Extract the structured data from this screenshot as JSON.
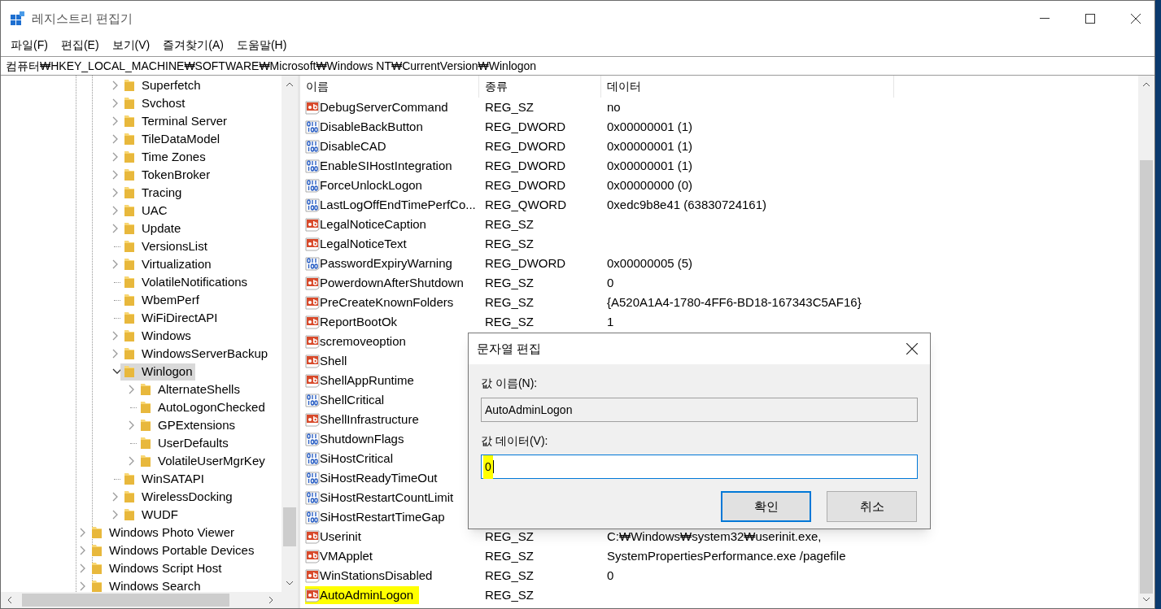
{
  "window": {
    "title": "레지스트리 편집기"
  },
  "menu": [
    "파일(F)",
    "편집(E)",
    "보기(V)",
    "즐겨찾기(A)",
    "도움말(H)"
  ],
  "address": "컴퓨터₩HKEY_LOCAL_MACHINE₩SOFTWARE₩Microsoft₩Windows NT₩CurrentVersion₩Winlogon",
  "tree": {
    "items": [
      {
        "kind": "branch",
        "label": "Superfetch",
        "expanded": false,
        "selected": false
      },
      {
        "kind": "branch",
        "label": "Svchost",
        "expanded": false,
        "selected": false
      },
      {
        "kind": "branch",
        "label": "Terminal Server",
        "expanded": false,
        "selected": false
      },
      {
        "kind": "branch",
        "label": "TileDataModel",
        "expanded": false,
        "selected": false
      },
      {
        "kind": "branch",
        "label": "Time Zones",
        "expanded": false,
        "selected": false
      },
      {
        "kind": "branch",
        "label": "TokenBroker",
        "expanded": false,
        "selected": false
      },
      {
        "kind": "branch",
        "label": "Tracing",
        "expanded": false,
        "selected": false
      },
      {
        "kind": "branch",
        "label": "UAC",
        "expanded": false,
        "selected": false
      },
      {
        "kind": "branch",
        "label": "Update",
        "expanded": false,
        "selected": false
      },
      {
        "kind": "leaf",
        "label": "VersionsList",
        "selected": false
      },
      {
        "kind": "branch",
        "label": "Virtualization",
        "expanded": false,
        "selected": false
      },
      {
        "kind": "leaf",
        "label": "VolatileNotifications",
        "selected": false
      },
      {
        "kind": "leaf",
        "label": "WbemPerf",
        "selected": false
      },
      {
        "kind": "leaf",
        "label": "WiFiDirectAPI",
        "selected": false
      },
      {
        "kind": "branch",
        "label": "Windows",
        "expanded": false,
        "selected": false
      },
      {
        "kind": "branch",
        "label": "WindowsServerBackup",
        "expanded": false,
        "selected": false
      },
      {
        "kind": "branch",
        "label": "Winlogon",
        "expanded": true,
        "selected": true,
        "children": [
          {
            "kind": "branch",
            "label": "AlternateShells",
            "expanded": false,
            "selected": false
          },
          {
            "kind": "leaf",
            "label": "AutoLogonChecked",
            "selected": false
          },
          {
            "kind": "branch",
            "label": "GPExtensions",
            "expanded": false,
            "selected": false
          },
          {
            "kind": "leaf",
            "label": "UserDefaults",
            "selected": false
          },
          {
            "kind": "branch",
            "label": "VolatileUserMgrKey",
            "expanded": false,
            "selected": false
          }
        ]
      },
      {
        "kind": "leaf",
        "label": "WinSATAPI",
        "selected": false
      },
      {
        "kind": "branch",
        "label": "WirelessDocking",
        "expanded": false,
        "selected": false
      },
      {
        "kind": "branch",
        "label": "WUDF",
        "expanded": false,
        "selected": false
      }
    ],
    "outer_items": [
      {
        "kind": "branch",
        "label": "Windows Photo Viewer",
        "expanded": false,
        "selected": false
      },
      {
        "kind": "branch",
        "label": "Windows Portable Devices",
        "expanded": false,
        "selected": false
      },
      {
        "kind": "branch",
        "label": "Windows Script Host",
        "expanded": false,
        "selected": false
      },
      {
        "kind": "branch",
        "label": "Windows Search",
        "expanded": false,
        "selected": false
      }
    ]
  },
  "list": {
    "columns": [
      "이름",
      "종류",
      "데이터"
    ],
    "rows": [
      {
        "kind": "string",
        "name": "DebugServerCommand",
        "type": "REG_SZ",
        "data": "no",
        "highlighted": false
      },
      {
        "kind": "binary",
        "name": "DisableBackButton",
        "type": "REG_DWORD",
        "data": "0x00000001 (1)",
        "highlighted": false
      },
      {
        "kind": "binary",
        "name": "DisableCAD",
        "type": "REG_DWORD",
        "data": "0x00000001 (1)",
        "highlighted": false
      },
      {
        "kind": "binary",
        "name": "EnableSIHostIntegration",
        "type": "REG_DWORD",
        "data": "0x00000001 (1)",
        "highlighted": false
      },
      {
        "kind": "binary",
        "name": "ForceUnlockLogon",
        "type": "REG_DWORD",
        "data": "0x00000000 (0)",
        "highlighted": false
      },
      {
        "kind": "binary",
        "name": "LastLogOffEndTimePerfCo...",
        "type": "REG_QWORD",
        "data": "0xedc9b8e41 (63830724161)",
        "highlighted": false
      },
      {
        "kind": "string",
        "name": "LegalNoticeCaption",
        "type": "REG_SZ",
        "highlighted": false
      },
      {
        "kind": "string",
        "name": "LegalNoticeText",
        "type": "REG_SZ",
        "highlighted": false
      },
      {
        "kind": "binary",
        "name": "PasswordExpiryWarning",
        "type": "REG_DWORD",
        "data": "0x00000005 (5)",
        "highlighted": false
      },
      {
        "kind": "string",
        "name": "PowerdownAfterShutdown",
        "type": "REG_SZ",
        "data": "0",
        "highlighted": false
      },
      {
        "kind": "string",
        "name": "PreCreateKnownFolders",
        "type": "REG_SZ",
        "data": "{A520A1A4-1780-4FF6-BD18-167343C5AF16}",
        "highlighted": false
      },
      {
        "kind": "string",
        "name": "ReportBootOk",
        "type": "REG_SZ",
        "data": "1",
        "highlighted": false
      },
      {
        "kind": "string",
        "name": "scremoveoption",
        "highlighted": false
      },
      {
        "kind": "string",
        "name": "Shell",
        "highlighted": false
      },
      {
        "kind": "string",
        "name": "ShellAppRuntime",
        "highlighted": false
      },
      {
        "kind": "binary",
        "name": "ShellCritical",
        "highlighted": false
      },
      {
        "kind": "string",
        "name": "ShellInfrastructure",
        "highlighted": false
      },
      {
        "kind": "binary",
        "name": "ShutdownFlags",
        "highlighted": false
      },
      {
        "kind": "binary",
        "name": "SiHostCritical",
        "highlighted": false
      },
      {
        "kind": "binary",
        "name": "SiHostReadyTimeOut",
        "highlighted": false
      },
      {
        "kind": "binary",
        "name": "SiHostRestartCountLimit",
        "highlighted": false
      },
      {
        "kind": "binary",
        "name": "SiHostRestartTimeGap",
        "highlighted": false
      },
      {
        "kind": "string",
        "name": "Userinit",
        "type": "REG_SZ",
        "data": "C:₩Windows₩system32₩userinit.exe,",
        "highlighted": false
      },
      {
        "kind": "string",
        "name": "VMApplet",
        "type": "REG_SZ",
        "data": "SystemPropertiesPerformance.exe /pagefile",
        "highlighted": false
      },
      {
        "kind": "string",
        "name": "WinStationsDisabled",
        "type": "REG_SZ",
        "data": "0",
        "highlighted": false
      },
      {
        "kind": "string",
        "name": "AutoAdminLogon",
        "type": "REG_SZ",
        "highlighted": true
      }
    ]
  },
  "dialog": {
    "title": "문자열 편집",
    "name_label": "값 이름(N):",
    "name_value": "AutoAdminLogon",
    "data_label": "값 데이터(V):",
    "data_value": "0",
    "data_highlighted": true,
    "buttons": [
      {
        "label": "확인",
        "default": true
      },
      {
        "label": "취소",
        "default": false
      }
    ]
  }
}
